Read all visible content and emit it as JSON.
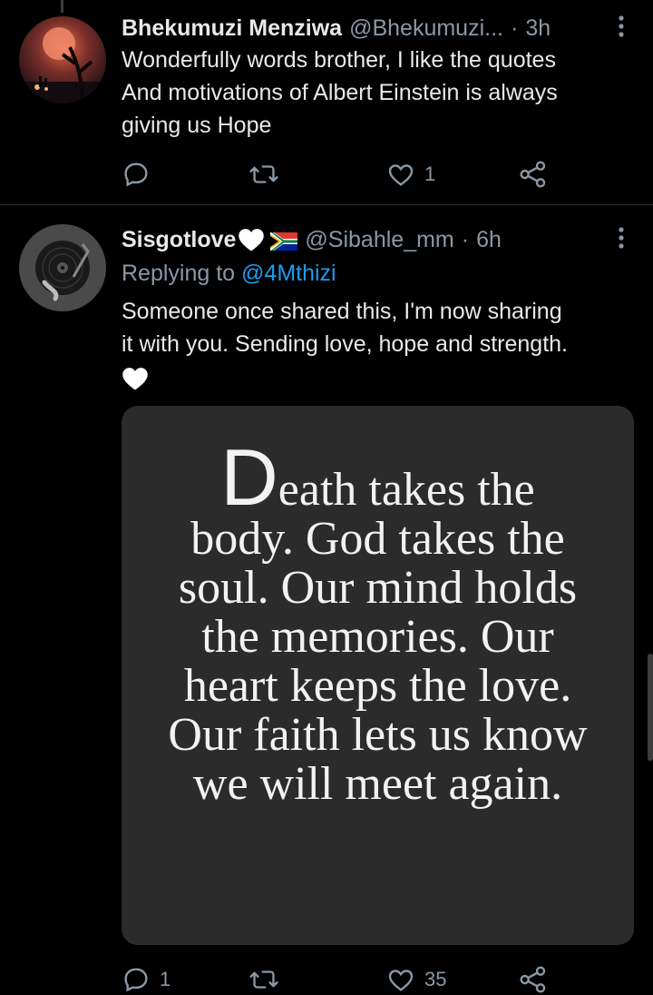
{
  "tweets": [
    {
      "display_name": "Bhekumuzi Menziwa",
      "handle": "@Bhekumuzi...",
      "time": "3h",
      "text": "Wonderfully words brother, I like the quotes\nAnd motivations of Albert Einstein is always\ngiving us Hope",
      "replies": "",
      "retweets": "",
      "likes": "1"
    },
    {
      "display_name": "Sisgotlove",
      "handle": "@Sibahle_mm",
      "time": "6h",
      "replying_to_prefix": "Replying to ",
      "replying_to_handle": "@4Mthizi",
      "text": "Someone once shared this, I'm now sharing\nit with you. Sending love, hope and strength.",
      "image_quote": {
        "dropcap": "D",
        "first_line": "eath takes the",
        "rest": "body. God takes the\nsoul. Our mind holds\nthe memories. Our\nheart keeps the love.\nOur faith lets us know\nwe will meet again."
      },
      "replies": "1",
      "retweets": "",
      "likes": "35"
    }
  ],
  "separator": "·",
  "colors": {
    "background": "#000000",
    "text": "#e7e9ea",
    "secondary": "#8b98a5",
    "link": "#1d9bf0",
    "divider": "#2f3336"
  },
  "icons": [
    "reply-icon",
    "retweet-icon",
    "like-icon",
    "share-icon",
    "more-icon",
    "heart-emoji",
    "south-africa-flag-icon"
  ]
}
